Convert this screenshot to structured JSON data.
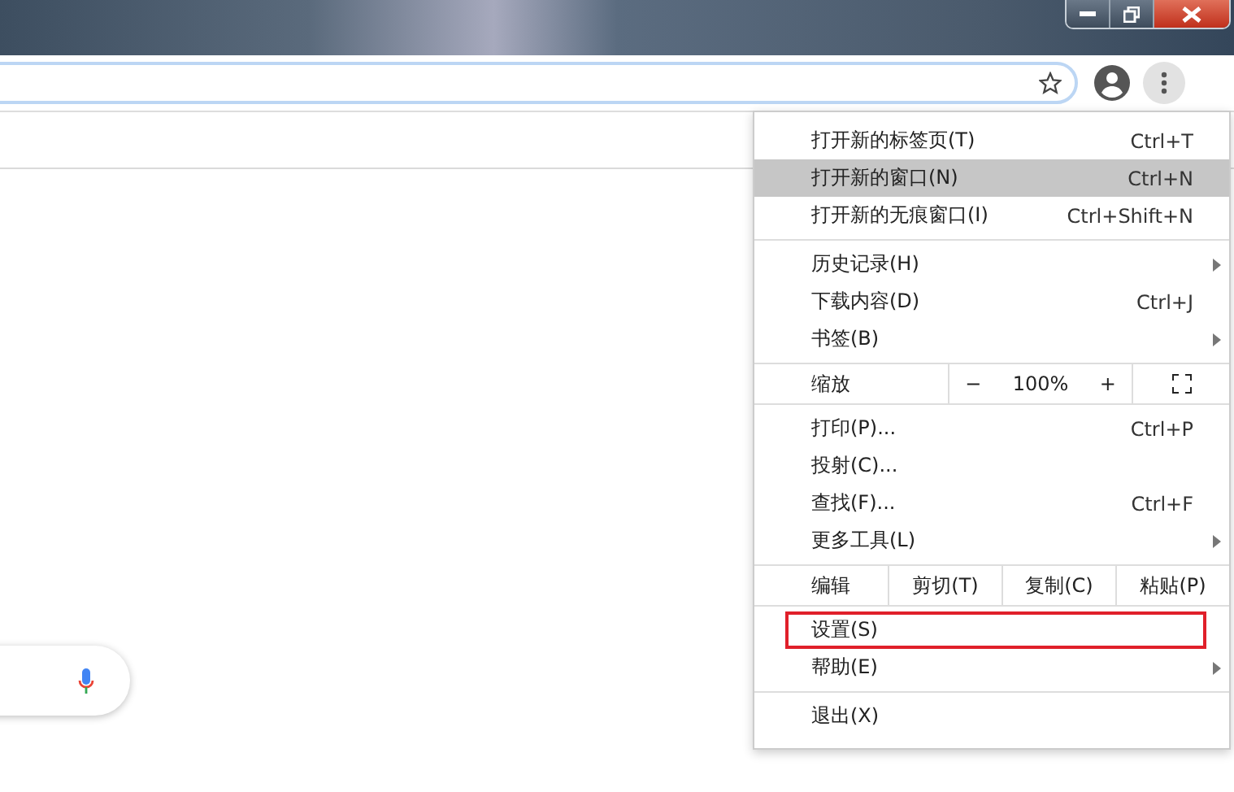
{
  "window_controls": [
    {
      "kind": "minimize"
    },
    {
      "kind": "restore"
    },
    {
      "kind": "close"
    }
  ],
  "menu": {
    "sections": [
      [
        {
          "kind": "command",
          "label": "打开新的标签页(T)",
          "shortcut": "Ctrl+T",
          "submenu": false,
          "selected": false,
          "outlined": false
        },
        {
          "kind": "command",
          "label": "打开新的窗口(N)",
          "shortcut": "Ctrl+N",
          "submenu": false,
          "selected": true,
          "outlined": false
        },
        {
          "kind": "command",
          "label": "打开新的无痕窗口(I)",
          "shortcut": "Ctrl+Shift+N",
          "submenu": false,
          "selected": false,
          "outlined": false
        }
      ],
      [
        {
          "kind": "command",
          "label": "历史记录(H)",
          "submenu": true,
          "selected": false,
          "outlined": false
        },
        {
          "kind": "command",
          "label": "下载内容(D)",
          "shortcut": "Ctrl+J",
          "submenu": false,
          "selected": false,
          "outlined": false
        },
        {
          "kind": "command",
          "label": "书签(B)",
          "submenu": true,
          "selected": false,
          "outlined": false
        }
      ],
      [
        {
          "kind": "zoom",
          "label": "缩放",
          "minus": "−",
          "value": "100%",
          "plus": "+"
        }
      ],
      [
        {
          "kind": "command",
          "label": "打印(P)...",
          "shortcut": "Ctrl+P",
          "submenu": false,
          "selected": false,
          "outlined": false
        },
        {
          "kind": "command",
          "label": "投射(C)...",
          "submenu": false,
          "selected": false,
          "outlined": false
        },
        {
          "kind": "command",
          "label": "查找(F)...",
          "shortcut": "Ctrl+F",
          "submenu": false,
          "selected": false,
          "outlined": false
        },
        {
          "kind": "command",
          "label": "更多工具(L)",
          "submenu": true,
          "selected": false,
          "outlined": false
        }
      ],
      [
        {
          "kind": "edit",
          "label": "编辑",
          "buttons": [
            "剪切(T)",
            "复制(C)",
            "粘贴(P)"
          ]
        }
      ],
      [
        {
          "kind": "command",
          "label": "设置(S)",
          "submenu": false,
          "selected": false,
          "outlined": true
        },
        {
          "kind": "command",
          "label": "帮助(E)",
          "submenu": true,
          "selected": false,
          "outlined": false
        }
      ],
      [
        {
          "kind": "command",
          "label": "退出(X)",
          "submenu": false,
          "selected": false,
          "outlined": false
        }
      ]
    ]
  }
}
